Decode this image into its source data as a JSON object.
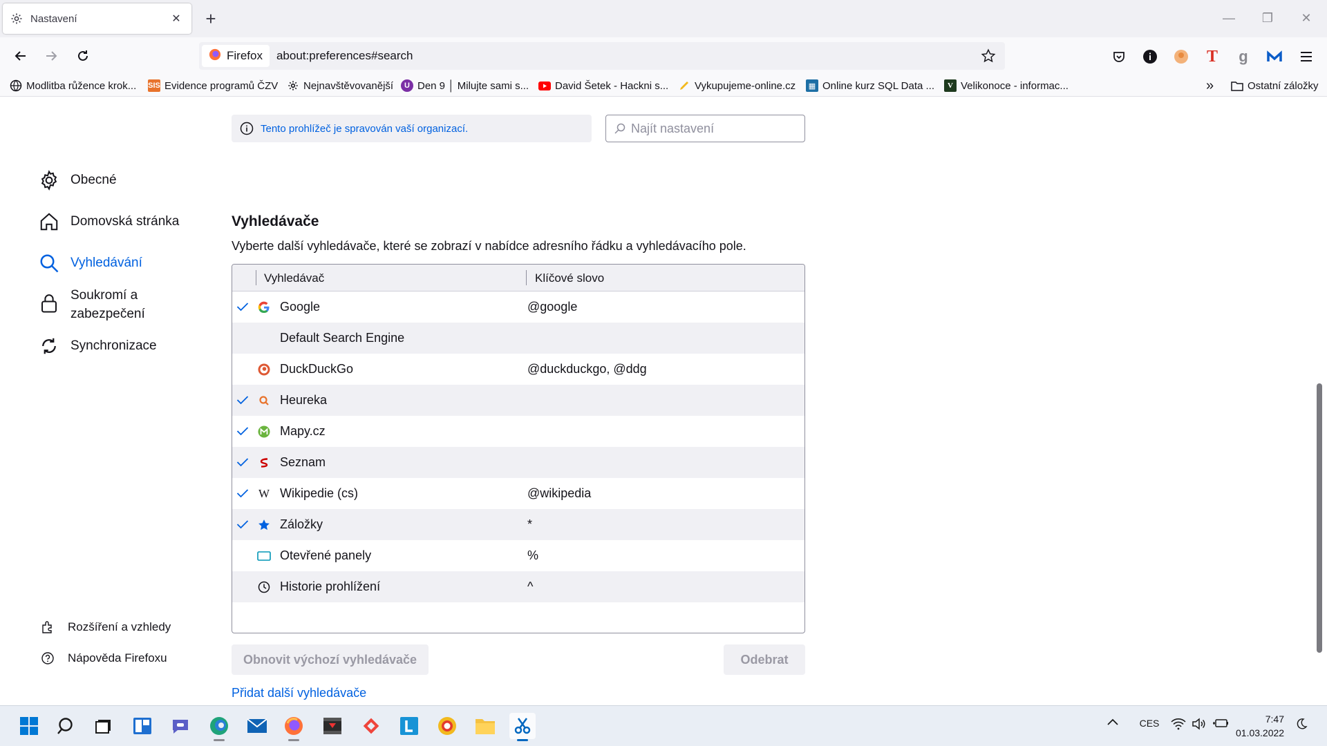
{
  "browser": {
    "tab_title": "Nastavení",
    "tab_close": "✕",
    "new_tab": "+",
    "identity_label": "Firefox",
    "url": "about:preferences#search"
  },
  "bookmarks": [
    {
      "label": "Modlitba růžence krok...",
      "icon": "globe-icon"
    },
    {
      "label": "Evidence programů ČZV",
      "icon": "sis-icon"
    },
    {
      "label": "Nejnavštěvovanější",
      "icon": "gear-icon"
    },
    {
      "label": "Den 9 │ Milujte sami s...",
      "icon": "purple-u-icon"
    },
    {
      "label": "David Šetek - Hackni s...",
      "icon": "youtube-icon"
    },
    {
      "label": "Vykupujeme-online.cz",
      "icon": "pen-icon"
    },
    {
      "label": "Online kurz SQL Data ...",
      "icon": "course-icon"
    },
    {
      "label": "Velikonoce - informac...",
      "icon": "v-icon"
    }
  ],
  "bookmarks_overflow": "»",
  "other_bookmarks": "Ostatní záložky",
  "prefs": {
    "policy_notice": "Tento prohlížeč je spravován vaší organizací.",
    "search_placeholder": "Najít nastavení",
    "categories": [
      {
        "label": "Obecné",
        "icon": "gear-icon"
      },
      {
        "label": "Domovská stránka",
        "icon": "home-icon"
      },
      {
        "label": "Vyhledávání",
        "icon": "search-icon"
      },
      {
        "label": "Soukromí a",
        "label2": "zabezpečení",
        "icon": "lock-icon"
      },
      {
        "label": "Synchronizace",
        "icon": "sync-icon"
      }
    ],
    "footer_links": [
      {
        "label": "Rozšíření a vzhledy",
        "icon": "puzzle-icon"
      },
      {
        "label": "Nápověda Firefoxu",
        "icon": "help-icon"
      }
    ],
    "section_title": "Vyhledávače",
    "section_desc": "Vyberte další vyhledávače, které se zobrazí v nabídce adresního řádku a vyhledávacího pole.",
    "table": {
      "col_engine": "Vyhledávač",
      "col_keyword": "Klíčové slovo",
      "rows": [
        {
          "name": "Google",
          "keyword": "@google",
          "checked": true,
          "icon": "google-icon"
        },
        {
          "name": "Default Search Engine",
          "keyword": "",
          "checked": false,
          "icon": ""
        },
        {
          "name": "DuckDuckGo",
          "keyword": "@duckduckgo, @ddg",
          "checked": false,
          "icon": "duckduckgo-icon"
        },
        {
          "name": "Heureka",
          "keyword": "",
          "checked": true,
          "icon": "heureka-icon"
        },
        {
          "name": "Mapy.cz",
          "keyword": "",
          "checked": true,
          "icon": "mapy-icon"
        },
        {
          "name": "Seznam",
          "keyword": "",
          "checked": true,
          "icon": "seznam-icon"
        },
        {
          "name": "Wikipedie (cs)",
          "keyword": "@wikipedia",
          "checked": true,
          "icon": "wikipedia-icon"
        },
        {
          "name": "Záložky",
          "keyword": "*",
          "checked": true,
          "icon": "star-icon"
        },
        {
          "name": "Otevřené panely",
          "keyword": "%",
          "checked": false,
          "icon": "tab-icon"
        },
        {
          "name": "Historie prohlížení",
          "keyword": "^",
          "checked": false,
          "icon": "clock-icon"
        }
      ]
    },
    "restore_button": "Obnovit výchozí vyhledávače",
    "remove_button": "Odebrat",
    "add_link": "Přidat další vyhledávače"
  },
  "taskbar": {
    "language": "CES",
    "time": "7:47",
    "date": "01.03.2022"
  },
  "colors": {
    "accent": "#0061e0",
    "checkmark": "#0061e0",
    "row_alt": "#f0f0f4"
  }
}
